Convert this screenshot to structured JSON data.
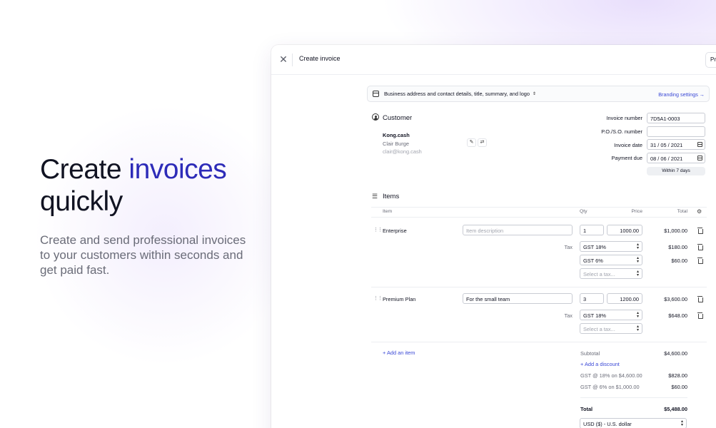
{
  "hero": {
    "title_line1_plain": "Create ",
    "title_line1_accent": "invoices",
    "title_line2": "quickly",
    "subtitle": "Create and send professional invoices to your customers within seconds and get paid fast."
  },
  "window": {
    "title": "Create invoice",
    "preview_button": "Pr",
    "business_bar": {
      "label": "Business address and contact details, title, summary, and logo",
      "branding_link": "Branding settings →"
    }
  },
  "customer": {
    "heading": "Customer",
    "company": "Kong.cash",
    "contact_name": "Clair Burge",
    "email": "clair@kong.cash"
  },
  "invoice_meta": {
    "invoice_number_label": "Invoice number",
    "invoice_number": "7D5A1-0003",
    "po_label": "P.O./S.O. number",
    "po_value": "",
    "invoice_date_label": "Invoice date",
    "invoice_date": "31 / 05 / 2021",
    "payment_due_label": "Payment due",
    "payment_due": "08 / 06 / 2021",
    "due_pill": "Within 7 days"
  },
  "items": {
    "heading": "Items",
    "columns": {
      "item": "Item",
      "qty": "Qty",
      "price": "Price",
      "total": "Total"
    },
    "rows": [
      {
        "name": "Enterprise",
        "description": "",
        "description_placeholder": "Item description",
        "qty": "1",
        "price": "1000.00",
        "total": "$1,000.00",
        "tax_label": "Tax",
        "taxes": [
          {
            "name": "GST 18%",
            "amount": "$180.00"
          },
          {
            "name": "GST 6%",
            "amount": "$60.00"
          }
        ],
        "tax_placeholder": "Select a tax..."
      },
      {
        "name": "Premium Plan",
        "description": "For the small team",
        "description_placeholder": "Item description",
        "qty": "3",
        "price": "1200.00",
        "total": "$3,600.00",
        "tax_label": "Tax",
        "taxes": [
          {
            "name": "GST 18%",
            "amount": "$648.00"
          }
        ],
        "tax_placeholder": "Select a tax..."
      }
    ],
    "add_item": "+ Add an item"
  },
  "summary": {
    "subtotal_label": "Subtotal",
    "subtotal": "$4,600.00",
    "add_discount": "+ Add a discount",
    "tax_lines": [
      {
        "label": "GST @ 18% on $4,600.00",
        "amount": "$828.00"
      },
      {
        "label": "GST @ 6% on $1,000.00",
        "amount": "$60.00"
      }
    ],
    "total_label": "Total",
    "total": "$5,488.00",
    "currency": "USD ($) - U.S. dollar"
  },
  "icons": {
    "close": "close-icon",
    "business": "card-icon",
    "customer": "user-icon",
    "edit": "pencil-icon",
    "swap": "swap-icon",
    "items": "list-icon",
    "settings": "gear-icon",
    "drag": "drag-handle-icon",
    "delete": "trash-icon",
    "calendar": "calendar-icon"
  },
  "colors": {
    "accent": "#2d2bb8",
    "link": "#3b49d6"
  }
}
